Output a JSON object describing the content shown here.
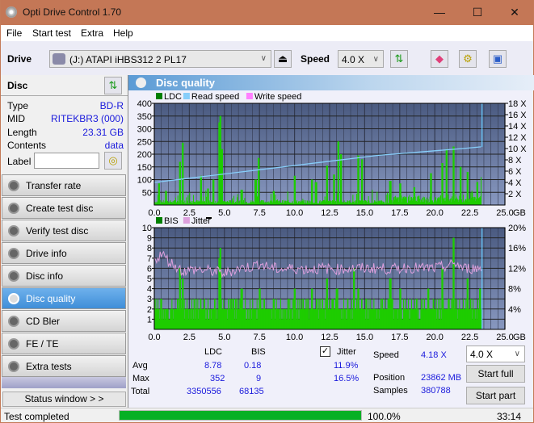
{
  "window": {
    "title": "Opti Drive Control 1.70",
    "minimize": "—",
    "maximize": "☐",
    "close": "✕"
  },
  "menu": [
    "File",
    "Start test",
    "Extra",
    "Help"
  ],
  "toolbar": {
    "drive_label": "Drive",
    "drive_value": "(J:)  ATAPI iHBS312   2 PL17",
    "speed_label": "Speed",
    "speed_value": "4.0 X"
  },
  "disc": {
    "header": "Disc",
    "fields": [
      {
        "label": "Type",
        "value": "BD-R"
      },
      {
        "label": "MID",
        "value": "RITEKBR3 (000)"
      },
      {
        "label": "Length",
        "value": "23.31 GB"
      },
      {
        "label": "Contents",
        "value": "data"
      }
    ],
    "label_field": "Label",
    "label_value": ""
  },
  "nav": [
    {
      "label": "Transfer rate",
      "active": false
    },
    {
      "label": "Create test disc",
      "active": false
    },
    {
      "label": "Verify test disc",
      "active": false
    },
    {
      "label": "Drive info",
      "active": false
    },
    {
      "label": "Disc info",
      "active": false
    },
    {
      "label": "Disc quality",
      "active": true
    },
    {
      "label": "CD Bler",
      "active": false
    },
    {
      "label": "FE / TE",
      "active": false
    },
    {
      "label": "Extra tests",
      "active": false
    }
  ],
  "status_window_btn": "Status window > >",
  "panel_title": "Disc quality",
  "chart_data": [
    {
      "type": "bar",
      "title": "LDC / Read speed",
      "legend": [
        {
          "name": "LDC",
          "color": "#008000"
        },
        {
          "name": "Read speed",
          "color": "#87cefa"
        },
        {
          "name": "Write speed",
          "color": "#ff80ff"
        }
      ],
      "xlabel": "GB",
      "xlim": [
        0,
        25
      ],
      "x_ticks": [
        "0.0",
        "2.5",
        "5.0",
        "7.5",
        "10.0",
        "12.5",
        "15.0",
        "17.5",
        "20.0",
        "22.5",
        "25.0"
      ],
      "ylim": [
        0,
        400
      ],
      "y_ticks": [
        "50",
        "100",
        "150",
        "200",
        "250",
        "300",
        "350",
        "400"
      ],
      "y2lim": [
        0,
        18
      ],
      "y2_ticks": [
        "2 X",
        "4 X",
        "6 X",
        "8 X",
        "10 X",
        "12 X",
        "14 X",
        "16 X",
        "18 X"
      ],
      "data_end": 23.31,
      "ldc_peaks": [
        [
          0.3,
          85
        ],
        [
          0.8,
          55
        ],
        [
          1.8,
          170
        ],
        [
          2.0,
          245
        ],
        [
          3.3,
          115
        ],
        [
          3.8,
          65
        ],
        [
          4.2,
          100
        ],
        [
          4.6,
          325
        ],
        [
          4.7,
          350
        ],
        [
          4.8,
          220
        ],
        [
          6.2,
          60
        ],
        [
          7.2,
          100
        ],
        [
          7.4,
          185
        ],
        [
          8.5,
          55
        ],
        [
          10.0,
          115
        ],
        [
          11.2,
          100
        ],
        [
          11.5,
          90
        ],
        [
          12.3,
          155
        ],
        [
          12.8,
          120
        ],
        [
          13.1,
          250
        ],
        [
          13.3,
          200
        ],
        [
          14.5,
          195
        ],
        [
          14.8,
          180
        ],
        [
          16.8,
          95
        ],
        [
          17.5,
          85
        ],
        [
          18.5,
          70
        ],
        [
          19.7,
          125
        ],
        [
          20.5,
          165
        ],
        [
          20.8,
          220
        ],
        [
          21.3,
          230
        ],
        [
          21.8,
          150
        ],
        [
          22.3,
          130
        ],
        [
          23.0,
          90
        ],
        [
          23.3,
          110
        ]
      ],
      "read_speed": [
        [
          0,
          4.0
        ],
        [
          1,
          4.3
        ],
        [
          2,
          4.6
        ],
        [
          3,
          4.9
        ],
        [
          4,
          5.2
        ],
        [
          5,
          5.5
        ],
        [
          6,
          5.8
        ],
        [
          7,
          6.1
        ],
        [
          8,
          6.4
        ],
        [
          9,
          6.7
        ],
        [
          10,
          7.0
        ],
        [
          11,
          7.3
        ],
        [
          12,
          7.6
        ],
        [
          13,
          7.9
        ],
        [
          14,
          8.2
        ],
        [
          15,
          8.5
        ],
        [
          16,
          8.8
        ],
        [
          17,
          9.0
        ],
        [
          18,
          9.2
        ],
        [
          19,
          9.4
        ],
        [
          20,
          9.6
        ],
        [
          21,
          9.8
        ],
        [
          22,
          10.0
        ],
        [
          23.3,
          10.3
        ]
      ],
      "avg_ldc": 8.78
    },
    {
      "type": "bar",
      "title": "BIS / Jitter",
      "legend": [
        {
          "name": "BIS",
          "color": "#008000"
        },
        {
          "name": "Jitter",
          "color": "#dda0dd"
        }
      ],
      "xlabel": "GB",
      "xlim": [
        0,
        25
      ],
      "x_ticks": [
        "0.0",
        "2.5",
        "5.0",
        "7.5",
        "10.0",
        "12.5",
        "15.0",
        "17.5",
        "20.0",
        "22.5",
        "25.0"
      ],
      "ylim": [
        0,
        10
      ],
      "y_ticks": [
        "1",
        "2",
        "3",
        "4",
        "5",
        "6",
        "7",
        "8",
        "9",
        "10"
      ],
      "y2lim": [
        0,
        20
      ],
      "y2_ticks": [
        "4%",
        "8%",
        "12%",
        "16%",
        "20%"
      ],
      "data_end": 23.31,
      "bis_base": 2,
      "bis_peaks": [
        [
          1.8,
          6
        ],
        [
          2.0,
          5
        ],
        [
          4.6,
          7
        ],
        [
          4.7,
          8
        ],
        [
          6.2,
          4
        ],
        [
          7.5,
          4
        ],
        [
          8.5,
          3
        ],
        [
          10.0,
          4
        ],
        [
          11.2,
          4
        ],
        [
          12.3,
          5
        ],
        [
          13.0,
          4
        ],
        [
          14.2,
          6
        ],
        [
          14.5,
          4
        ],
        [
          16.8,
          5
        ],
        [
          17.5,
          4
        ],
        [
          19.5,
          4
        ],
        [
          20.5,
          6
        ],
        [
          21.3,
          9
        ],
        [
          22.3,
          5
        ],
        [
          23.2,
          4
        ]
      ],
      "jitter": [
        [
          0,
          13.5
        ],
        [
          0.5,
          15
        ],
        [
          1,
          13.5
        ],
        [
          1.5,
          12.5
        ],
        [
          2,
          11.5
        ],
        [
          3,
          11.8
        ],
        [
          4,
          11.5
        ],
        [
          5,
          11.0
        ],
        [
          6,
          12.0
        ],
        [
          7,
          12.3
        ],
        [
          7.5,
          13.0
        ],
        [
          8,
          12.3
        ],
        [
          9,
          11.8
        ],
        [
          10,
          12.0
        ],
        [
          11,
          11.8
        ],
        [
          12,
          12.0
        ],
        [
          13,
          11.8
        ],
        [
          14,
          12.0
        ],
        [
          15,
          12.0
        ],
        [
          16,
          12.0
        ],
        [
          17,
          11.8
        ],
        [
          18,
          12.2
        ],
        [
          19,
          12.0
        ],
        [
          20,
          12.0
        ],
        [
          21,
          12.5
        ],
        [
          21.5,
          13.0
        ],
        [
          22,
          12.0
        ],
        [
          23.3,
          12.0
        ]
      ]
    }
  ],
  "stats": {
    "col_ldc": "LDC",
    "col_bis": "BIS",
    "jitter_label": "Jitter",
    "jitter_checked": true,
    "rows": [
      {
        "label": "Avg",
        "ldc": "8.78",
        "bis": "0.18",
        "jitter": "11.9%"
      },
      {
        "label": "Max",
        "ldc": "352",
        "bis": "9",
        "jitter": "16.5%"
      },
      {
        "label": "Total",
        "ldc": "3350556",
        "bis": "68135",
        "jitter": ""
      }
    ],
    "speed_label": "Speed",
    "speed_value": "4.18 X",
    "position_label": "Position",
    "position_value": "23862 MB",
    "samples_label": "Samples",
    "samples_value": "380788",
    "speed_select": "4.0 X",
    "start_full": "Start full",
    "start_part": "Start part"
  },
  "statusbar": {
    "text": "Test completed",
    "progress": 100.0,
    "progress_text": "100.0%",
    "time": "33:14"
  }
}
